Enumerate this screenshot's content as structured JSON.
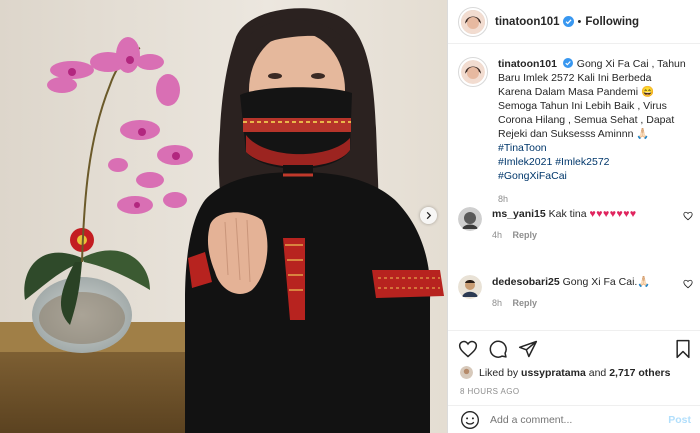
{
  "post": {
    "username": "tinatoon101",
    "follow_status": "Following",
    "caption_text": "Gong Xi Fa Cai , Tahun Baru Imlek 2572 Kali Ini Berbeda Karena Dalam Masa Pandemi 😄 Semoga Tahun Ini Lebih Baik , Virus Corona Hilang , Semua Sehat , Dapat Rejeki dan Suksesss Aminnn 🙏🏻",
    "hashtags": [
      "#TinaToon",
      "#Imlek2021",
      "#Imlek2572",
      "#GongXiFaCai"
    ],
    "caption_age": "8h"
  },
  "comments": [
    {
      "username": "ms_yani15",
      "text": "Kak tina",
      "emoji": "♥♥♥♥♥♥♥",
      "age": "4h",
      "reply_label": "Reply"
    },
    {
      "username": "dedesobari25",
      "text": "Gong Xi Fa Cai.🙏🏻",
      "age": "8h",
      "reply_label": "Reply"
    }
  ],
  "likes": {
    "prefix": "Liked by",
    "user": "ussypratama",
    "connector": "and",
    "others": "2,717 others"
  },
  "timestamp": "8 HOURS AGO",
  "composer": {
    "placeholder": "Add a comment...",
    "post_label": "Post"
  },
  "colors": {
    "link": "#00376b",
    "verified": "#3897f0",
    "post_disabled": "#b2dffc",
    "heart": "#e0245e"
  },
  "icons": [
    "verified-icon",
    "heart-icon",
    "comment-icon",
    "share-icon",
    "bookmark-icon",
    "emoji-icon",
    "chevron-right-icon"
  ]
}
